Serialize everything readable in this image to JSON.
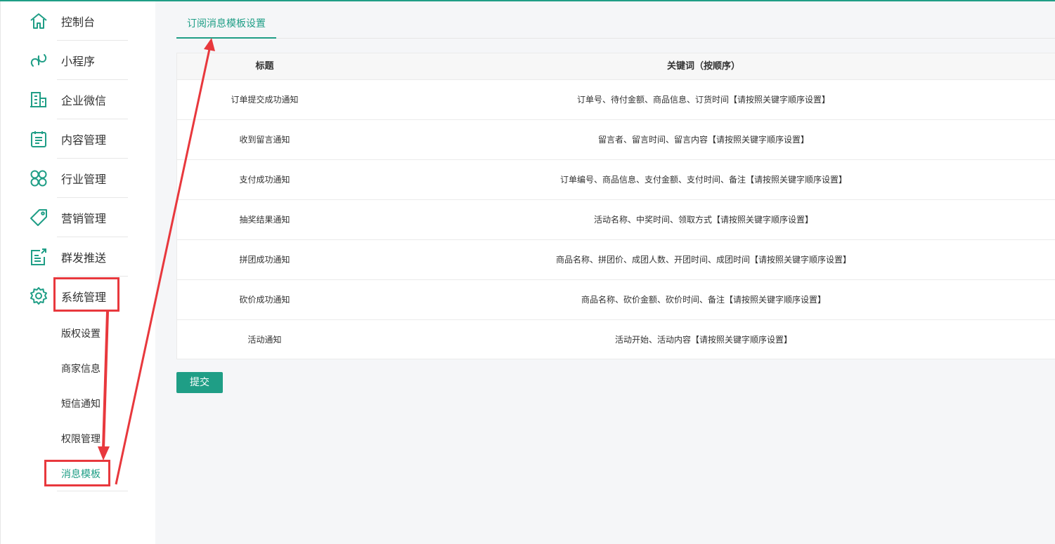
{
  "sidebar": {
    "items": [
      {
        "label": "控制台",
        "icon": "home-icon"
      },
      {
        "label": "小程序",
        "icon": "miniprogram-icon"
      },
      {
        "label": "企业微信",
        "icon": "building-icon"
      },
      {
        "label": "内容管理",
        "icon": "clipboard-icon"
      },
      {
        "label": "行业管理",
        "icon": "clover-icon"
      },
      {
        "label": "营销管理",
        "icon": "tag-icon"
      },
      {
        "label": "群发推送",
        "icon": "share-icon"
      },
      {
        "label": "系统管理",
        "icon": "gear-icon"
      }
    ],
    "sub_items": [
      {
        "label": "版权设置"
      },
      {
        "label": "商家信息"
      },
      {
        "label": "短信通知"
      },
      {
        "label": "权限管理"
      },
      {
        "label": "消息模板",
        "active": true
      }
    ]
  },
  "main": {
    "tab_label": "订阅消息模板设置",
    "table": {
      "headers": [
        "标题",
        "关键词（按顺序）"
      ],
      "rows": [
        [
          "订单提交成功通知",
          "订单号、待付金额、商品信息、订货时间【请按照关键字顺序设置】"
        ],
        [
          "收到留言通知",
          "留言者、留言时间、留言内容【请按照关键字顺序设置】"
        ],
        [
          "支付成功通知",
          "订单编号、商品信息、支付金额、支付时间、备注【请按照关键字顺序设置】"
        ],
        [
          "抽奖结果通知",
          "活动名称、中奖时间、领取方式【请按照关键字顺序设置】"
        ],
        [
          "拼团成功通知",
          "商品名称、拼团价、成团人数、开团时间、成团时间【请按照关键字顺序设置】"
        ],
        [
          "砍价成功通知",
          "商品名称、砍价金额、砍价时间、备注【请按照关键字顺序设置】"
        ],
        [
          "活动通知",
          "活动开始、活动内容【请按照关键字顺序设置】"
        ]
      ]
    },
    "submit_label": "提交"
  },
  "colors": {
    "accent": "#1f9e86",
    "annotation": "#e8383d"
  }
}
